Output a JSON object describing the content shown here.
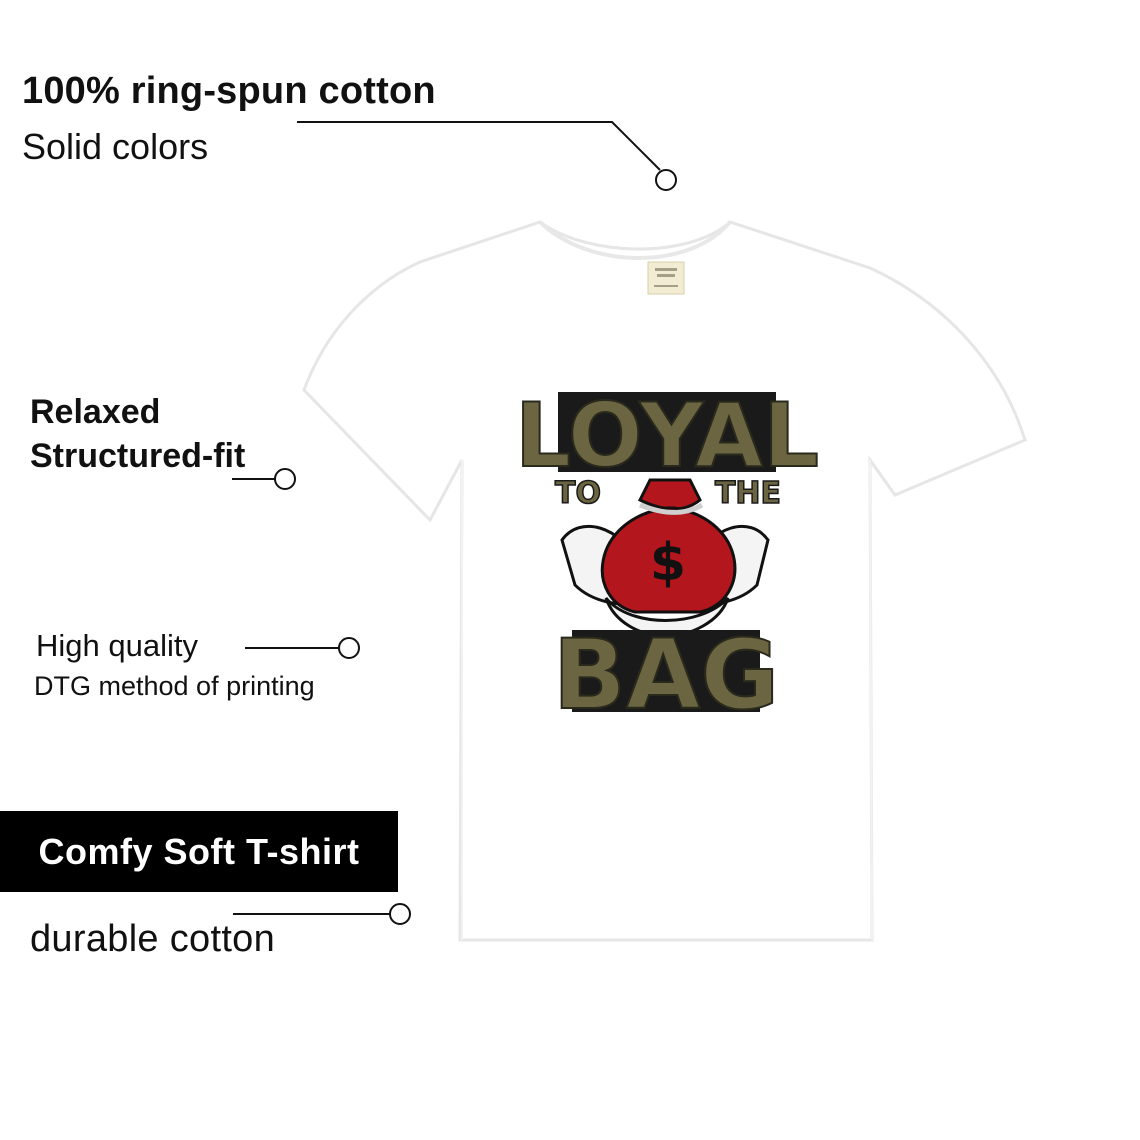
{
  "features": {
    "cotton_title": "100% ring-spun cotton",
    "cotton_sub": "Solid colors",
    "fit_line1": "Relaxed",
    "fit_line2": "Structured-fit",
    "quality_line1": "High quality",
    "quality_line2": "DTG method of printing",
    "banner_label": "Comfy Soft T-shirt",
    "durable": "durable cotton"
  },
  "design": {
    "word_top": "LOYAL",
    "word_left": "TO",
    "word_right": "THE",
    "word_bottom": "BAG",
    "symbol": "$"
  },
  "colors": {
    "olive": "#6b6542",
    "bag_red": "#b3161c",
    "banner": "#000000"
  }
}
